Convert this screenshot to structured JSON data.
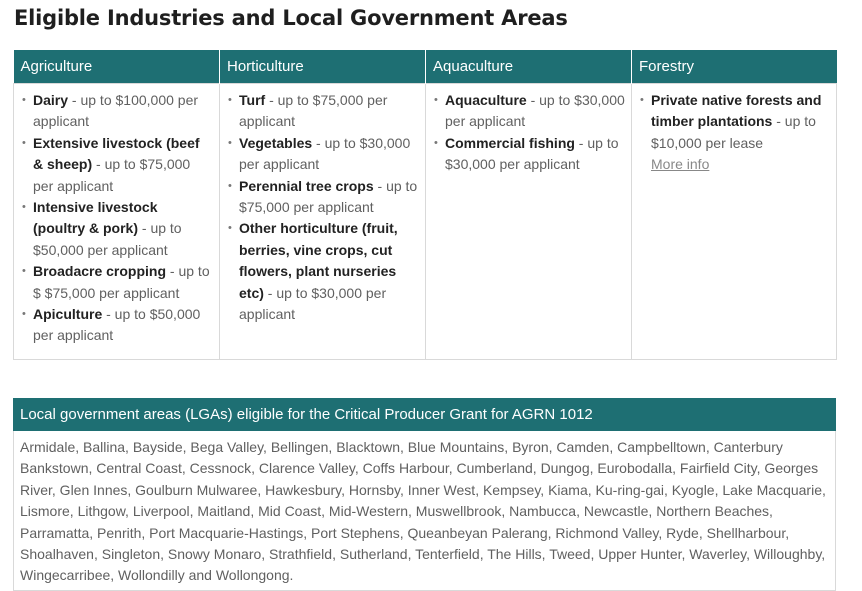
{
  "page": {
    "title": "Eligible Industries and Local Government Areas"
  },
  "industries": [
    {
      "heading": "Agriculture",
      "items": [
        {
          "name": "Dairy",
          "detail": " - up to $100,000 per applicant"
        },
        {
          "name": "Extensive livestock (beef & sheep)",
          "detail": " - up to $75,000 per applicant"
        },
        {
          "name": "Intensive livestock (poultry & pork)",
          "detail": " - up to $50,000 per applicant"
        },
        {
          "name": "Broadacre cropping",
          "detail": " - up to $ $75,000 per applicant"
        },
        {
          "name": "Apiculture",
          "detail": " - up to $50,000 per applicant"
        }
      ]
    },
    {
      "heading": "Horticulture",
      "items": [
        {
          "name": "Turf",
          "detail": " - up to $75,000 per applicant"
        },
        {
          "name": "Vegetables",
          "detail": " - up to $30,000 per applicant"
        },
        {
          "name": "Perennial tree crops",
          "detail": " - up to $75,000 per applicant"
        },
        {
          "name": "Other horticulture (fruit, berries, vine crops, cut flowers, plant nurseries etc)",
          "detail": " - up to $30,000 per applicant"
        }
      ]
    },
    {
      "heading": "Aquaculture",
      "items": [
        {
          "name": "Aquaculture",
          "detail": " - up to $30,000 per applicant"
        },
        {
          "name": "Commercial fishing",
          "detail": " - up to $30,000 per applicant"
        }
      ]
    },
    {
      "heading": "Forestry",
      "items": [
        {
          "name": "Private native forests and timber plantations",
          "detail": " - up to $10,000 per lease"
        }
      ],
      "link": "More info"
    }
  ],
  "lga": {
    "heading": "Local government areas (LGAs) eligible for the Critical Producer Grant for AGRN 1012",
    "list": "Armidale, Ballina, Bayside, Bega Valley, Bellingen, Blacktown, Blue Mountains, Byron, Camden, Campbelltown, Canterbury Bankstown, Central Coast, Cessnock, Clarence Valley, Coffs Harbour, Cumberland, Dungog, Eurobodalla, Fairfield City, Georges River, Glen Innes, Goulburn Mulwaree, Hawkesbury, Hornsby, Inner West, Kempsey, Kiama, Ku-ring-gai, Kyogle, Lake Macquarie, Lismore, Lithgow, Liverpool, Maitland, Mid Coast, Mid-Western, Muswellbrook, Nambucca, Newcastle, Northern Beaches, Parramatta, Penrith, Port Macquarie-Hastings, Port Stephens, Queanbeyan Palerang, Richmond Valley, Ryde, Shellharbour, Shoalhaven, Singleton, Snowy Monaro, Strathfield, Sutherland, Tenterfield, The Hills, Tweed, Upper Hunter, Waverley, Willoughby, Wingecarribee, Wollondilly and Wollongong."
  },
  "colors": {
    "header_bg": "#1e6f73",
    "border": "#d9d9d9"
  }
}
